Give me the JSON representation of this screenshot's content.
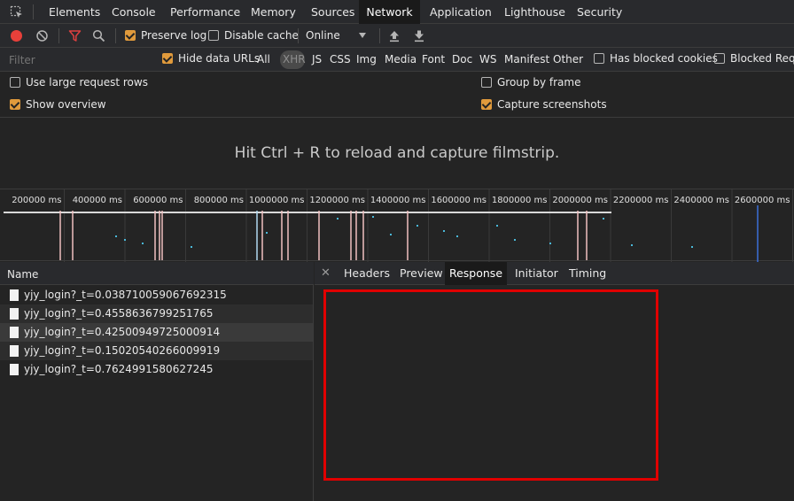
{
  "tabs": [
    {
      "label": "Elements"
    },
    {
      "label": "Console"
    },
    {
      "label": "Performance"
    },
    {
      "label": "Memory"
    },
    {
      "label": "Sources"
    },
    {
      "label": "Network"
    },
    {
      "label": "Application"
    },
    {
      "label": "Lighthouse"
    },
    {
      "label": "Security"
    }
  ],
  "active_tab": "Network",
  "toolbar": {
    "preserve_log": "Preserve log",
    "preserve_log_checked": true,
    "disable_cache": "Disable cache",
    "disable_cache_checked": false,
    "throttling": "Online"
  },
  "filter": {
    "placeholder": "Filter",
    "hide_data_urls": "Hide data URLs",
    "hide_data_urls_checked": true,
    "types": [
      "All",
      "XHR",
      "JS",
      "CSS",
      "Img",
      "Media",
      "Font",
      "Doc",
      "WS",
      "Manifest",
      "Other"
    ],
    "selected_type": "XHR",
    "has_blocked_cookies": "Has blocked cookies",
    "blocked_requests": "Blocked Requ"
  },
  "settings": {
    "large_rows": "Use large request rows",
    "large_rows_checked": false,
    "show_overview": "Show overview",
    "show_overview_checked": true,
    "group_by_frame": "Group by frame",
    "group_by_frame_checked": false,
    "capture_screenshots": "Capture screenshots",
    "capture_screenshots_checked": true
  },
  "filmstrip_message": "Hit Ctrl + R to reload and capture filmstrip.",
  "overview_ticks": [
    "200000 ms",
    "400000 ms",
    "600000 ms",
    "800000 ms",
    "1000000 ms",
    "1200000 ms",
    "1400000 ms",
    "1600000 ms",
    "1800000 ms",
    "2000000 ms",
    "2200000 ms",
    "2400000 ms",
    "2600000 ms"
  ],
  "request_list": {
    "column_name": "Name",
    "rows": [
      "yjy_login?_t=0.038710059067692315",
      "yjy_login?_t=0.4558636799251765",
      "yjy_login?_t=0.42500949725000914",
      "yjy_login?_t=0.15020540266009919",
      "yjy_login?_t=0.7624991580627245"
    ]
  },
  "detail_tabs": [
    "Headers",
    "Preview",
    "Response",
    "Initiator",
    "Timing"
  ],
  "active_detail_tab": "Response",
  "colors": {
    "accent": "#e09a3c",
    "record": "#e8403a",
    "filter_icon": "#e04040",
    "highlight_box": "#e00000",
    "timeline_marker": "#3b6fd8"
  }
}
